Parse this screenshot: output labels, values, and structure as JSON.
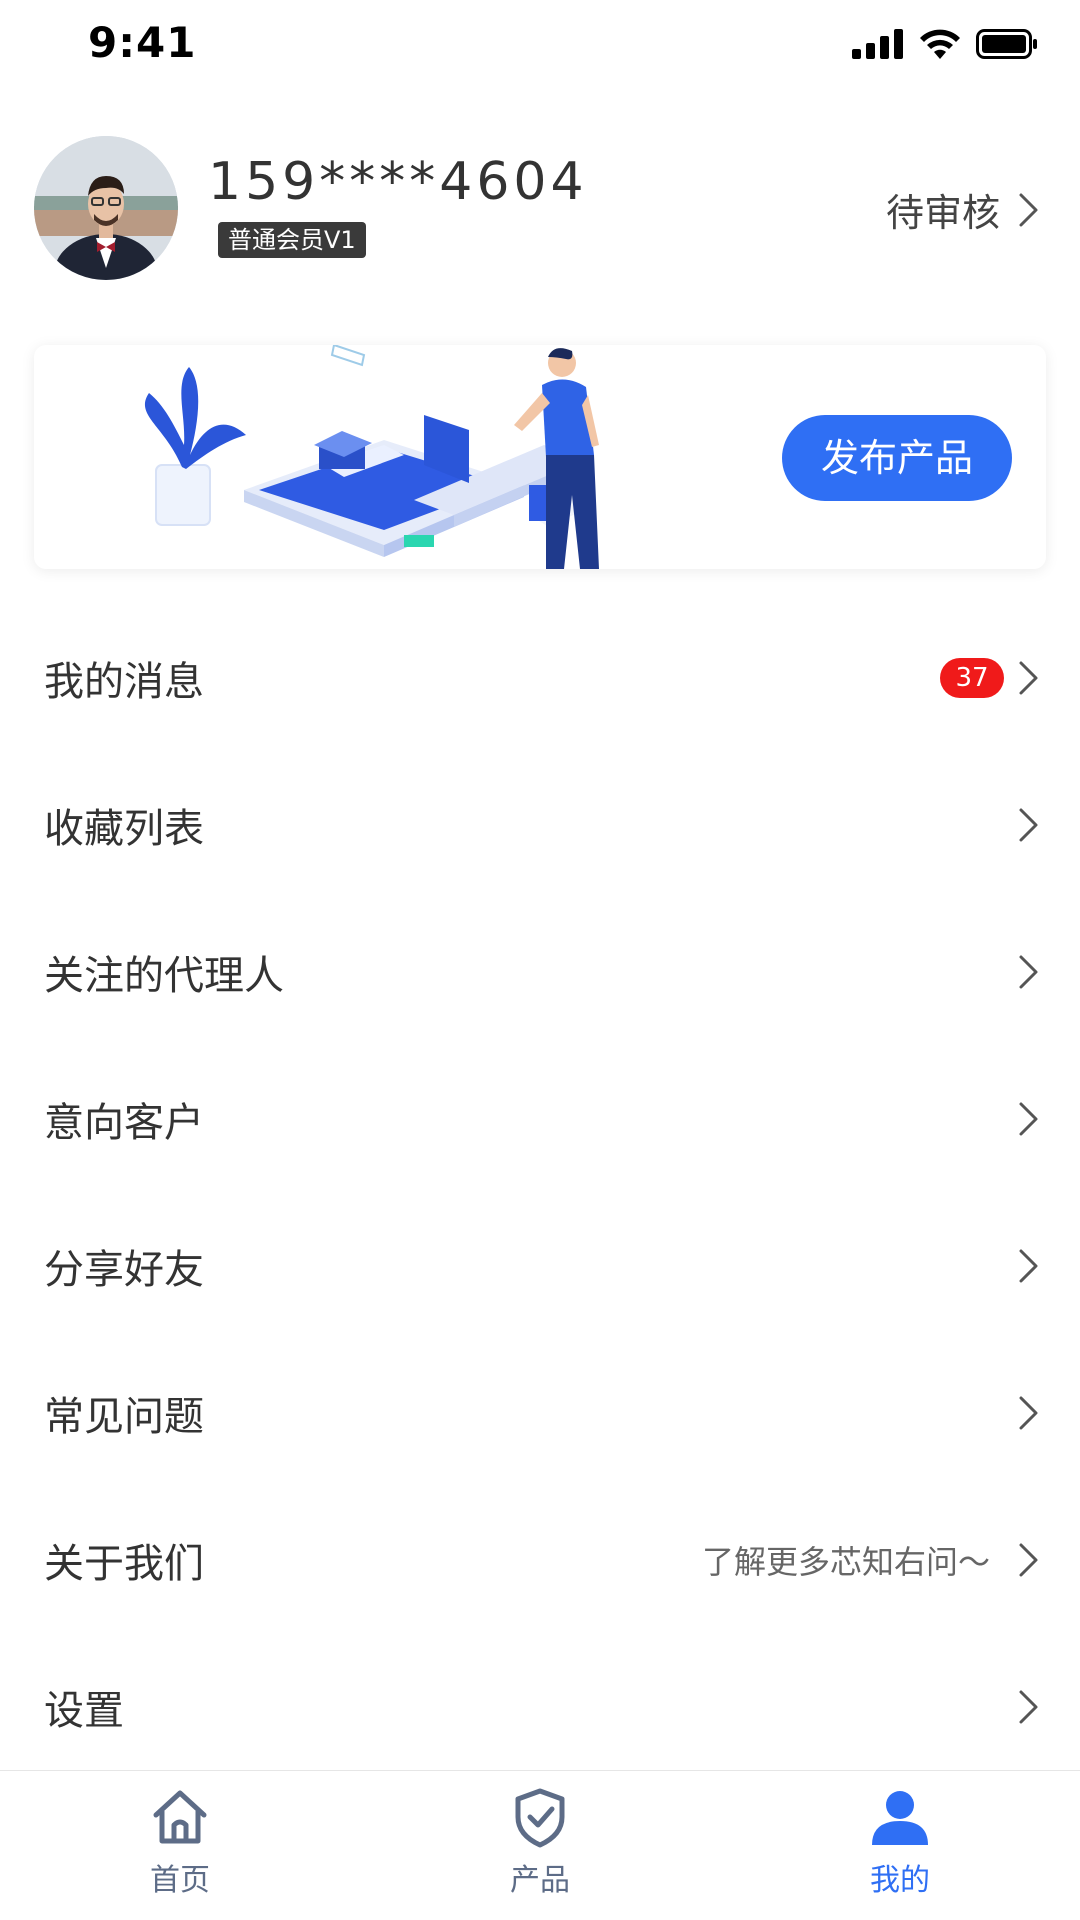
{
  "status_bar": {
    "time": "9:41"
  },
  "profile": {
    "phone": "159****4604",
    "member_level": "普通会员V1",
    "review_status": "待审核"
  },
  "banner": {
    "button_label": "发布产品"
  },
  "menu": {
    "items": [
      {
        "label": "我的消息",
        "badge": "37",
        "hint": ""
      },
      {
        "label": "收藏列表",
        "badge": "",
        "hint": ""
      },
      {
        "label": "关注的代理人",
        "badge": "",
        "hint": ""
      },
      {
        "label": "意向客户",
        "badge": "",
        "hint": ""
      },
      {
        "label": "分享好友",
        "badge": "",
        "hint": ""
      },
      {
        "label": "常见问题",
        "badge": "",
        "hint": ""
      },
      {
        "label": "关于我们",
        "badge": "",
        "hint": "了解更多芯知右问～"
      },
      {
        "label": "设置",
        "badge": "",
        "hint": ""
      }
    ]
  },
  "tab_bar": {
    "tabs": [
      {
        "label": "首页",
        "icon": "home-icon",
        "active": false
      },
      {
        "label": "产品",
        "icon": "shield-check-icon",
        "active": false
      },
      {
        "label": "我的",
        "icon": "user-icon",
        "active": true
      }
    ]
  },
  "colors": {
    "accent": "#2f6ff4",
    "badge": "#f01a1a",
    "tab_inactive": "#5d6c87"
  }
}
